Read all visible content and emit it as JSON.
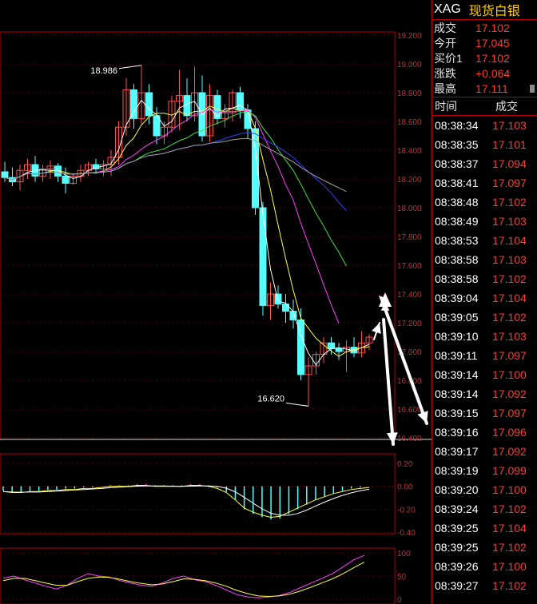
{
  "header": {
    "symbol": "XAG",
    "name": "现货白银"
  },
  "quote": [
    {
      "label": "成交",
      "value": "17.102"
    },
    {
      "label": "今开",
      "value": "17.045"
    },
    {
      "label": "买价1",
      "value": "17.102"
    },
    {
      "label": "涨跌",
      "value": "+0.064"
    },
    {
      "label": "最高",
      "value": "17.111"
    }
  ],
  "trades_header": {
    "time": "时间",
    "price": "成交"
  },
  "trades": [
    {
      "time": "08:38:34",
      "price": "17.103"
    },
    {
      "time": "08:38:35",
      "price": "17.101"
    },
    {
      "time": "08:38:37",
      "price": "17.094"
    },
    {
      "time": "08:38:41",
      "price": "17.097"
    },
    {
      "time": "08:38:48",
      "price": "17.102"
    },
    {
      "time": "08:38:49",
      "price": "17.103"
    },
    {
      "time": "08:38:53",
      "price": "17.104"
    },
    {
      "time": "08:38:58",
      "price": "17.103"
    },
    {
      "time": "08:38:58",
      "price": "17.102"
    },
    {
      "time": "08:39:04",
      "price": "17.104"
    },
    {
      "time": "08:39:05",
      "price": "17.102"
    },
    {
      "time": "08:39:10",
      "price": "17.103"
    },
    {
      "time": "08:39:11",
      "price": "17.097"
    },
    {
      "time": "08:39:14",
      "price": "17.100"
    },
    {
      "time": "08:39:14",
      "price": "17.092"
    },
    {
      "time": "08:39:15",
      "price": "17.097"
    },
    {
      "time": "08:39:16",
      "price": "17.096"
    },
    {
      "time": "08:39:17",
      "price": "17.092"
    },
    {
      "time": "08:39:19",
      "price": "17.099"
    },
    {
      "time": "08:39:20",
      "price": "17.100"
    },
    {
      "time": "08:39:24",
      "price": "17.102"
    },
    {
      "time": "08:39:25",
      "price": "17.104"
    },
    {
      "time": "08:39:25",
      "price": "17.102"
    },
    {
      "time": "08:39:26",
      "price": "17.100"
    },
    {
      "time": "08:39:27",
      "price": "17.102"
    }
  ],
  "chart_data": [
    {
      "type": "candlestick",
      "title": "",
      "ylim": [
        16.4,
        19.2
      ],
      "yticks": [
        "19.200",
        "19.000",
        "18.800",
        "18.600",
        "18.400",
        "18.200",
        "18.000",
        "17.800",
        "17.600",
        "17.400",
        "17.200",
        "17.000",
        "16.800",
        "16.600",
        "16.400"
      ],
      "annotations": [
        {
          "text": "18.986"
        },
        {
          "text": "16.620"
        }
      ],
      "candles": [
        [
          18.25,
          18.32,
          18.18,
          18.21
        ],
        [
          18.21,
          18.28,
          18.15,
          18.18
        ],
        [
          18.18,
          18.3,
          18.12,
          18.26
        ],
        [
          18.26,
          18.34,
          18.2,
          18.3
        ],
        [
          18.3,
          18.36,
          18.18,
          18.22
        ],
        [
          18.22,
          18.3,
          18.18,
          18.27
        ],
        [
          18.27,
          18.33,
          18.2,
          18.29
        ],
        [
          18.29,
          18.31,
          18.18,
          18.22
        ],
        [
          18.22,
          18.28,
          18.1,
          18.17
        ],
        [
          18.17,
          18.24,
          18.16,
          18.22
        ],
        [
          18.22,
          18.3,
          18.18,
          18.26
        ],
        [
          18.26,
          18.32,
          18.22,
          18.3
        ],
        [
          18.3,
          18.34,
          18.24,
          18.27
        ],
        [
          18.27,
          18.33,
          18.22,
          18.3
        ],
        [
          18.3,
          18.4,
          18.22,
          18.35
        ],
        [
          18.35,
          18.6,
          18.3,
          18.56
        ],
        [
          18.56,
          18.9,
          18.5,
          18.82
        ],
        [
          18.82,
          18.86,
          18.55,
          18.62
        ],
        [
          18.62,
          18.99,
          18.58,
          18.8
        ],
        [
          18.8,
          18.86,
          18.58,
          18.64
        ],
        [
          18.64,
          18.7,
          18.44,
          18.5
        ],
        [
          18.5,
          18.6,
          18.44,
          18.56
        ],
        [
          18.56,
          18.78,
          18.52,
          18.74
        ],
        [
          18.74,
          18.96,
          18.54,
          18.78
        ],
        [
          18.78,
          18.9,
          18.6,
          18.64
        ],
        [
          18.64,
          18.98,
          18.6,
          18.8
        ],
        [
          18.8,
          18.92,
          18.46,
          18.5
        ],
        [
          18.5,
          18.86,
          18.46,
          18.78
        ],
        [
          18.78,
          18.82,
          18.58,
          18.62
        ],
        [
          18.62,
          18.72,
          18.56,
          18.66
        ],
        [
          18.66,
          18.82,
          18.6,
          18.8
        ],
        [
          18.8,
          18.84,
          18.62,
          18.68
        ],
        [
          18.68,
          18.72,
          18.48,
          18.55
        ],
        [
          18.55,
          18.6,
          17.95,
          18.0
        ],
        [
          18.0,
          18.04,
          17.25,
          17.32
        ],
        [
          17.32,
          17.48,
          17.22,
          17.4
        ],
        [
          17.4,
          17.46,
          17.3,
          17.33
        ],
        [
          17.33,
          17.4,
          17.2,
          17.28
        ],
        [
          17.28,
          17.36,
          17.16,
          17.22
        ],
        [
          17.22,
          17.3,
          16.8,
          16.84
        ],
        [
          16.84,
          16.96,
          16.62,
          16.9
        ],
        [
          16.9,
          17.0,
          16.84,
          16.98
        ],
        [
          16.98,
          17.1,
          16.92,
          17.06
        ],
        [
          17.06,
          17.1,
          16.98,
          17.02
        ],
        [
          17.02,
          17.06,
          16.94,
          17.0
        ],
        [
          17.0,
          17.08,
          16.86,
          17.03
        ],
        [
          17.03,
          17.1,
          16.96,
          16.99
        ],
        [
          16.99,
          17.14,
          16.96,
          17.06
        ],
        [
          17.06,
          17.12,
          17.01,
          17.1
        ]
      ]
    },
    {
      "type": "bar",
      "title": "",
      "ylim": [
        -0.4,
        0.2
      ],
      "yticks": [
        "0.20",
        "0.00",
        "-0.20",
        "-0.40"
      ],
      "values": [
        -0.04,
        -0.05,
        -0.05,
        -0.04,
        -0.04,
        -0.03,
        -0.03,
        -0.02,
        -0.02,
        -0.01,
        -0.01,
        0,
        0.01,
        0.01,
        0.01,
        0.02,
        0.02,
        0.01,
        0.01,
        0.01,
        0.01,
        0.02,
        0.02,
        0.01,
        -0.01,
        -0.05,
        -0.12,
        -0.2,
        -0.24,
        -0.27,
        -0.29,
        -0.28,
        -0.24,
        -0.2,
        -0.16,
        -0.12,
        -0.09,
        -0.06,
        -0.04,
        -0.02,
        -0.01,
        0
      ]
    },
    {
      "type": "line",
      "title": "",
      "ylim": [
        0,
        100
      ],
      "yticks": [
        "100",
        "50",
        "0"
      ],
      "series": [
        {
          "values": [
            45,
            50,
            42,
            35,
            28,
            22,
            30,
            45,
            55,
            50,
            48,
            40,
            35,
            30,
            28,
            35,
            45,
            50,
            42,
            38,
            30,
            20,
            10,
            5,
            3,
            5,
            8,
            15,
            25,
            35,
            45,
            55,
            70,
            85,
            95
          ]
        },
        {
          "values": [
            40,
            45,
            45,
            40,
            35,
            30,
            30,
            38,
            45,
            48,
            47,
            43,
            38,
            34,
            31,
            33,
            38,
            44,
            43,
            40,
            35,
            28,
            19,
            12,
            7,
            6,
            7,
            11,
            18,
            26,
            35,
            44,
            55,
            68,
            80
          ]
        }
      ]
    }
  ]
}
